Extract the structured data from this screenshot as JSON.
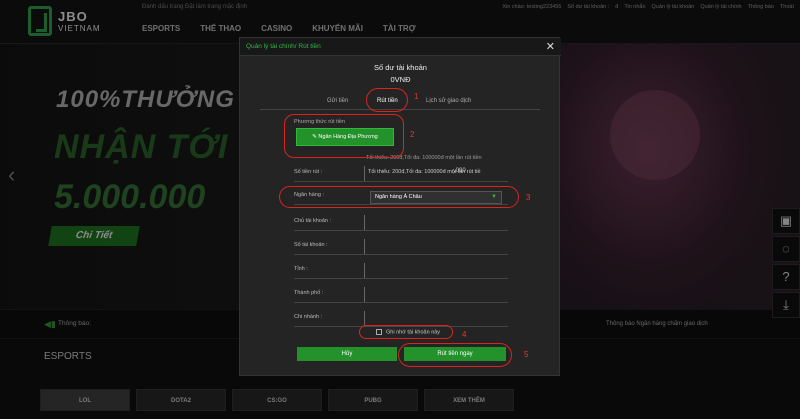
{
  "header": {
    "logo_main": "JBO",
    "logo_sub": "VIETNAM",
    "tagline": "Đánh dấu trang Đặt làm trang mặc định",
    "greeting": "Xin chào: testing223456",
    "balance_label": "Số dư tài khoản :",
    "balance_value": "đ",
    "inbox": "Tin nhắn",
    "account_mgmt": "Quản lý tài khoản",
    "finance_mgmt": "Quản lý tài chính",
    "notifications": "Thông báo",
    "logout": "Thoát",
    "nav": [
      "ESPORTS",
      "THỂ THAO",
      "CASINO",
      "KHUYẾN MÃI",
      "TÀI TRỢ"
    ]
  },
  "banner": {
    "line1": "100%THƯỞNG",
    "line2": "NHẬN TỚI",
    "line3": "5.000.000",
    "detail_button": "Chi Tiết"
  },
  "notice": {
    "label": "Thông báo:",
    "text": "Thông báo Ngân hàng chấm giao dịch"
  },
  "esports": {
    "title": "ESPORTS",
    "games": [
      "LOL",
      "DOTA2",
      "CS:GO",
      "PUBG",
      "XEM THÊM"
    ]
  },
  "modal": {
    "title": "Quản lý tài chính/ Rút tiền",
    "balance_label": "Số dư tài khoản",
    "balance_value": "0VNĐ",
    "tabs": [
      "Gửi tiền",
      "Rút tiền",
      "Lịch sử giao dịch"
    ],
    "method_label": "Phương thức rút tiền",
    "method_button": "Ngân Hàng Địa Phương",
    "limit_hint": "Tối thiểu: 200đ,Tối đa: 100000đ một lần rút tiền",
    "amount_label": "Số tiền rút :",
    "amount_placeholder": "Tối thiểu: 200đ,Tối đa: 100000đ một lần rút tiề",
    "amount_suffix": ",000",
    "bank_label": "Ngân hàng :",
    "bank_selected": "Ngân hàng Á Châu",
    "fields": [
      "Chủ tài khoản :",
      "Số tài khoản :",
      "Tỉnh :",
      "Thành phố :",
      "Chi nhánh :"
    ],
    "remember_label": "Ghi nhớ tài khoản này",
    "cancel_button": "Hủy",
    "submit_button": "Rút tiền ngay"
  },
  "annotations": [
    "1",
    "2",
    "3",
    "4",
    "5"
  ],
  "colors": {
    "accent": "#23922b",
    "annotation": "#d9241f"
  }
}
